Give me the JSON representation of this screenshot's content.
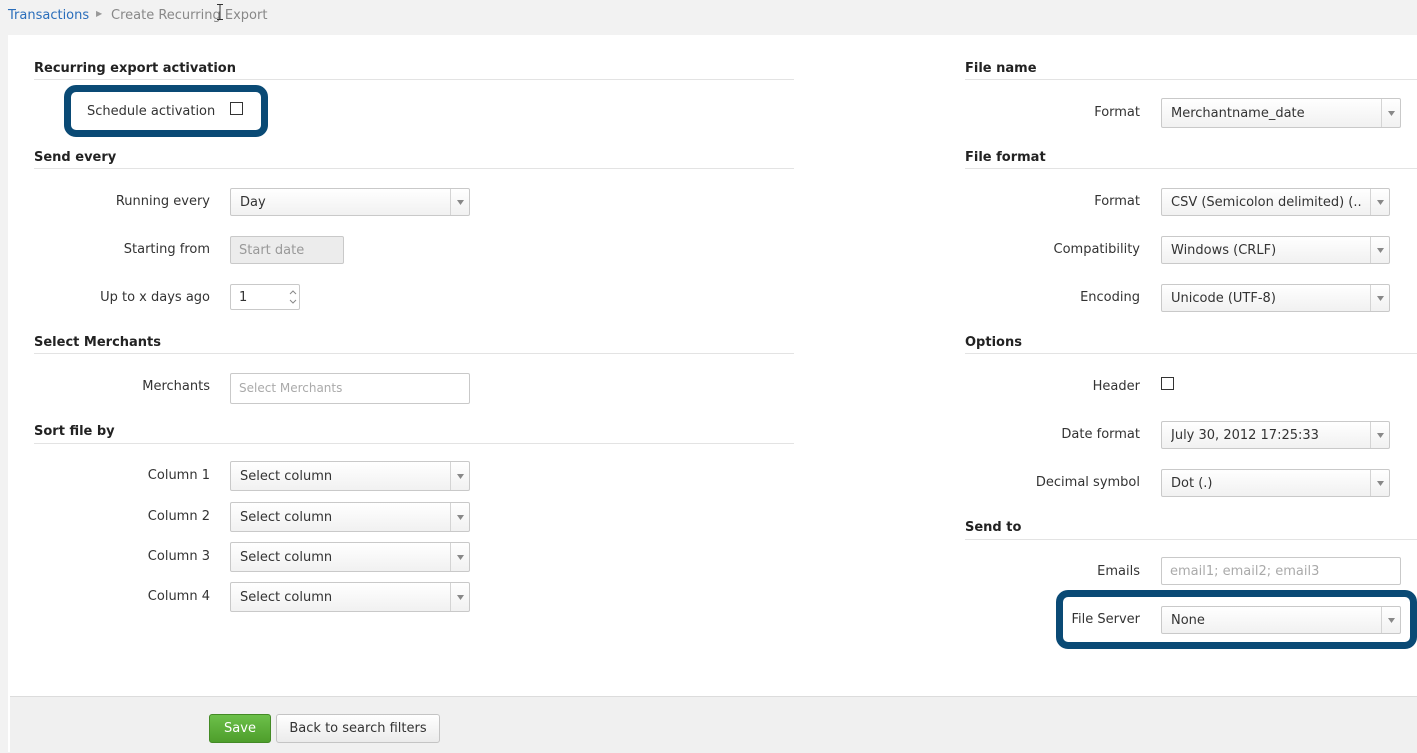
{
  "breadcrumb": {
    "link": "Transactions",
    "current": "Create Recurring Export"
  },
  "left": {
    "activation": {
      "title": "Recurring export activation",
      "schedule_label": "Schedule activation"
    },
    "send_every": {
      "title": "Send every",
      "running_every_label": "Running every",
      "running_every_value": "Day",
      "starting_from_label": "Starting from",
      "starting_from_placeholder": "Start date",
      "days_ago_label": "Up to x days ago",
      "days_ago_value": "1"
    },
    "merchants": {
      "title": "Select Merchants",
      "label": "Merchants",
      "placeholder": "Select Merchants"
    },
    "sort": {
      "title": "Sort file by",
      "columns": [
        {
          "label": "Column 1",
          "value": "Select column"
        },
        {
          "label": "Column 2",
          "value": "Select column"
        },
        {
          "label": "Column 3",
          "value": "Select column"
        },
        {
          "label": "Column 4",
          "value": "Select column"
        }
      ]
    }
  },
  "right": {
    "file_name": {
      "title": "File name",
      "format_label": "Format",
      "format_value": "Merchantname_date"
    },
    "file_format": {
      "title": "File format",
      "format_label": "Format",
      "format_value": "CSV (Semicolon delimited) (...",
      "compat_label": "Compatibility",
      "compat_value": "Windows (CRLF)",
      "encoding_label": "Encoding",
      "encoding_value": "Unicode (UTF-8)"
    },
    "options": {
      "title": "Options",
      "header_label": "Header",
      "date_format_label": "Date format",
      "date_format_value": "July 30, 2012 17:25:33",
      "decimal_label": "Decimal symbol",
      "decimal_value": "Dot (.)"
    },
    "send_to": {
      "title": "Send to",
      "emails_label": "Emails",
      "emails_placeholder": "email1; email2; email3",
      "file_server_label": "File Server",
      "file_server_value": "None"
    }
  },
  "footer": {
    "save_label": "Save",
    "back_label": "Back to search filters"
  },
  "colors": {
    "highlight": "#0a4a75",
    "save_green": "#5cae37",
    "link_blue": "#2a6ebb"
  }
}
